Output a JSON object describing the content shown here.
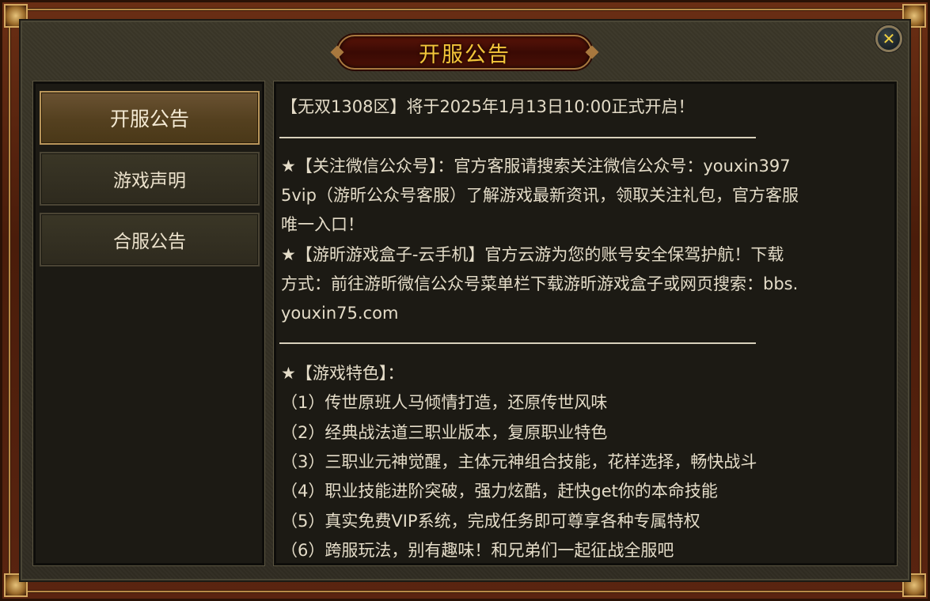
{
  "window": {
    "title": "开服公告",
    "close_icon": "close-icon"
  },
  "sidebar": {
    "tabs": [
      {
        "label": "开服公告",
        "active": true
      },
      {
        "label": "游戏声明",
        "active": false
      },
      {
        "label": "合服公告",
        "active": false
      }
    ]
  },
  "content": {
    "line1": "【无双1308区】将于2025年1月13日10:00正式开启！",
    "wechat": [
      "★【关注微信公众号】：官方客服请搜索关注微信公众号：youxin397",
      "5vip（游昕公众号客服）了解游戏最新资讯，领取关注礼包，官方客服",
      "唯一入口！"
    ],
    "cloud": [
      "★【游昕游戏盒子-云手机】官方云游为您的账号安全保驾护航！下载",
      "方式：前往游昕微信公众号菜单栏下载游昕游戏盒子或网页搜索：bbs.",
      "youxin75.com"
    ],
    "features_title": "★【游戏特色】：",
    "features": [
      "（1）传世原班人马倾情打造，还原传世风味",
      "（2）经典战法道三职业版本，复原职业特色",
      "（3）三职业元神觉醒，主体元神组合技能，花样选择，畅快战斗",
      "（4）职业技能进阶突破，强力炫酷，赶快get你的本命技能",
      "（5）真实免费VIP系统，完成任务即可尊享各种专属特权",
      "（6）跨服玩法，别有趣味！和兄弟们一起征战全服吧"
    ]
  },
  "colors": {
    "title_gold": "#f2c53a",
    "text": "#e4dcc8",
    "frame_red": "#5a2410"
  }
}
